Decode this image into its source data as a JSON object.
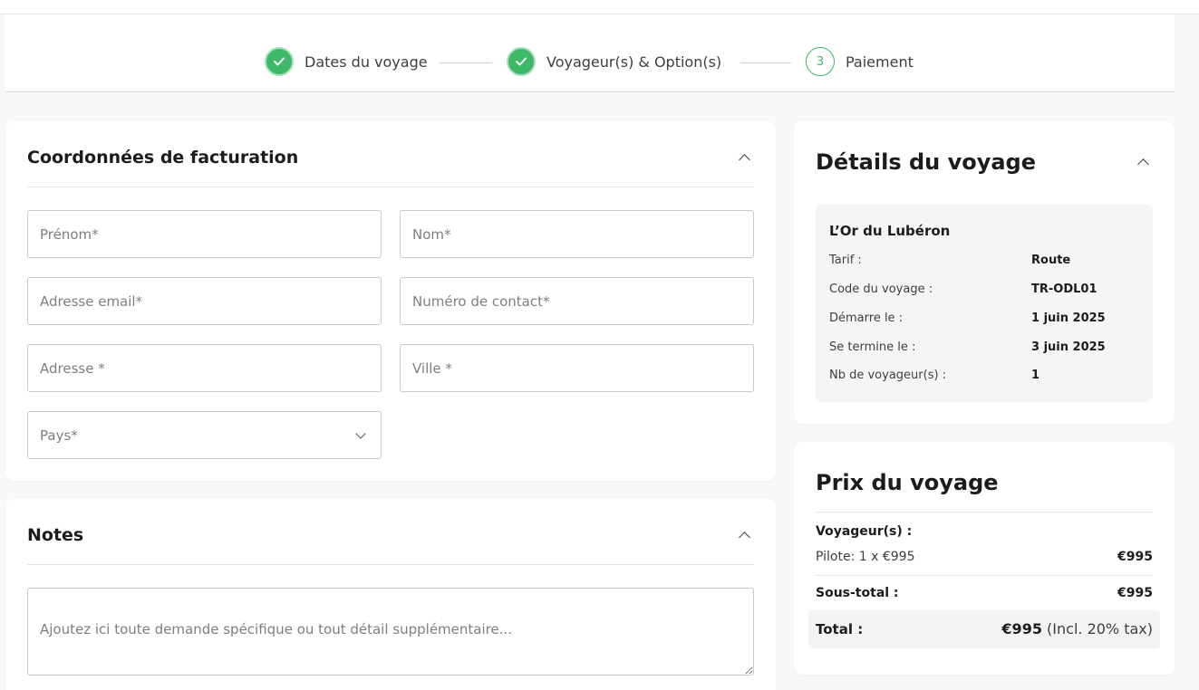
{
  "stepper": {
    "steps": [
      {
        "label": "Dates du voyage",
        "status": "done"
      },
      {
        "label": "Voyageur(s) & Option(s)",
        "status": "done"
      },
      {
        "label": "Paiement",
        "status": "current",
        "number": "3"
      }
    ]
  },
  "billing": {
    "title": "Coordonnées de facturation",
    "fields": {
      "first_name": "Prénom*",
      "last_name": "Nom*",
      "email": "Adresse email*",
      "phone": "Numéro de contact*",
      "address": "Adresse *",
      "city": "Ville *",
      "country": "Pays*"
    }
  },
  "notes": {
    "title": "Notes",
    "placeholder": "Ajoutez ici toute demande spécifique ou tout détail supplémentaire..."
  },
  "trip_details": {
    "title": "Détails du voyage",
    "name": "L’Or du Lubéron",
    "rows": [
      {
        "key": "Tarif :",
        "value": "Route"
      },
      {
        "key": "Code du voyage :",
        "value": "TR-ODL01"
      },
      {
        "key": "Démarre le :",
        "value": "1 juin 2025"
      },
      {
        "key": "Se termine le :",
        "value": "3 juin 2025"
      },
      {
        "key": "Nb de voyageur(s) :",
        "value": "1"
      }
    ]
  },
  "price": {
    "title": "Prix du voyage",
    "travellers_label": "Voyageur(s) :",
    "line_label": "Pilote: 1 x €995",
    "line_value": "€995",
    "subtotal_label": "Sous-total :",
    "subtotal_value": "€995",
    "total_label": "Total :",
    "total_value": "€995",
    "total_note": "(Incl. 20% tax)"
  },
  "colors": {
    "accent": "#3fb869",
    "background": "#f7f8f8",
    "card": "#ffffff"
  }
}
